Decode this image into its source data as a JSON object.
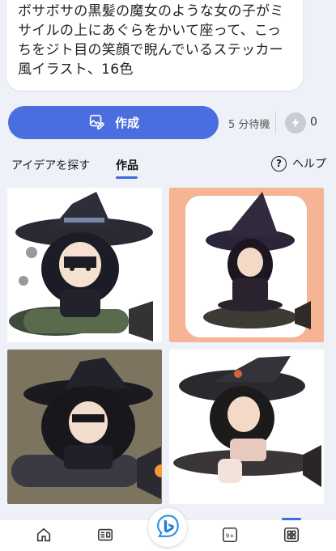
{
  "prompt": {
    "text": "ボサボサの黒髪の魔女のような女の子がミサイルの上にあぐらをかいて座って、こっちをジト目の笑顔で睨んでいるステッカー風イラスト、16色"
  },
  "create": {
    "label": "作成",
    "wait_text": "5 分待機",
    "boost_count": "0"
  },
  "tabs": {
    "explore": "アイデアを探す",
    "creations": "作品",
    "help": "ヘルプ",
    "help_glyph": "?"
  },
  "images": [
    {
      "name": "witch-sticker-1",
      "background": "#ffffff"
    },
    {
      "name": "witch-sticker-2",
      "background": "#f5b493"
    },
    {
      "name": "witch-sticker-3",
      "background": "#7d7460"
    },
    {
      "name": "witch-sticker-4",
      "background": "#ffffff"
    }
  ],
  "bottom_nav": {
    "items": [
      {
        "icon": "home-icon"
      },
      {
        "icon": "news-icon"
      },
      {
        "icon": "bing-chat-icon"
      },
      {
        "icon": "tabs-icon",
        "badge": "9+"
      },
      {
        "icon": "apps-icon"
      }
    ]
  },
  "colors": {
    "accent": "#4a6ee0",
    "tab_underline": "#3c6de0"
  }
}
